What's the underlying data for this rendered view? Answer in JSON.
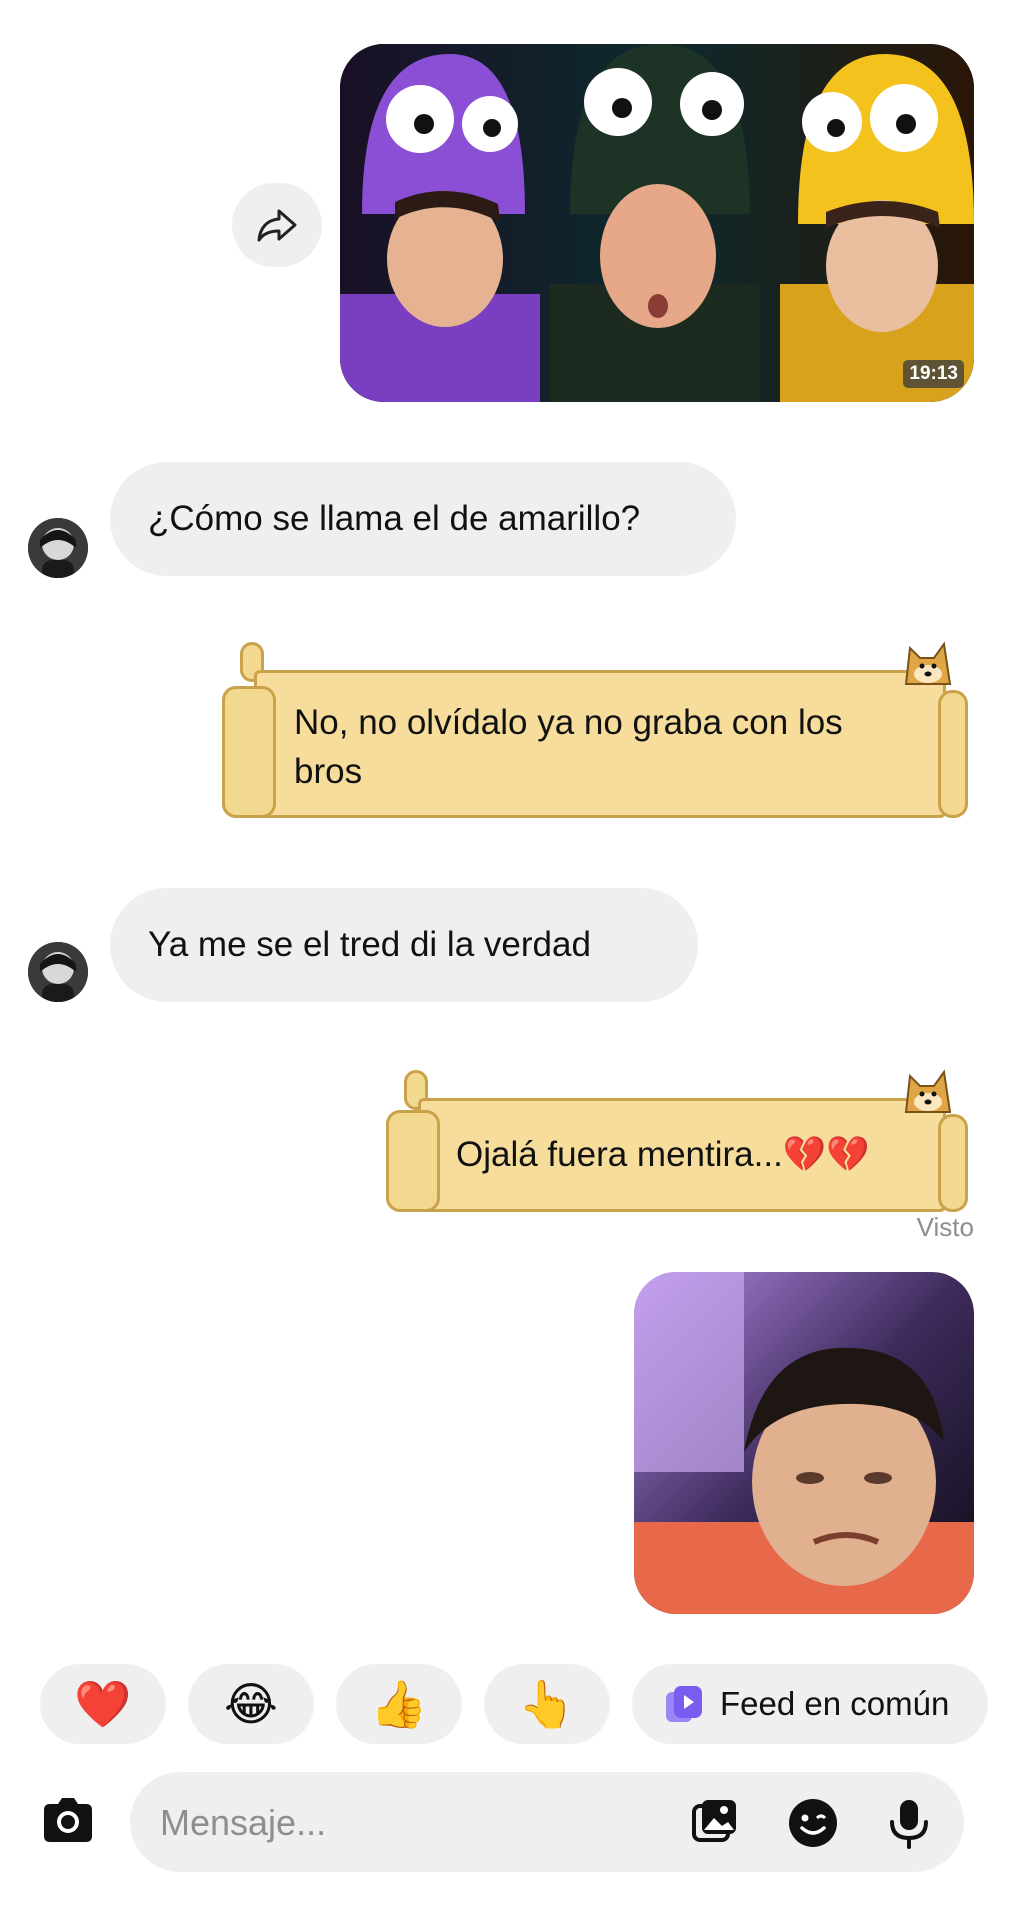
{
  "shared_video": {
    "duration": "19:13"
  },
  "messages": [
    {
      "from": "them",
      "text": "¿Cómo se llama el de amarillo?"
    },
    {
      "from": "me",
      "lines": [
        "No, no olvídalo ya no graba con los",
        "bros"
      ]
    },
    {
      "from": "them",
      "text": "Ya me se el tred di la verdad"
    },
    {
      "from": "me",
      "text": "Ojalá fuera mentira...💔💔"
    }
  ],
  "seen_label": "Visto",
  "quick_reactions": [
    "❤️",
    "😂",
    "👍",
    "👆"
  ],
  "feed_chip": {
    "label": "Feed en común"
  },
  "composer": {
    "placeholder": "Mensaje..."
  },
  "icons": {
    "share": "share-arrow-icon",
    "camera": "camera-icon",
    "gallery": "gallery-icon",
    "sticker": "sticker-icon",
    "mic": "microphone-icon",
    "feed": "shared-feed-icon"
  },
  "colors": {
    "scroll_fill": "#f6dd9b",
    "scroll_border": "#c9a24a",
    "bubble_in": "#efefef",
    "feed_icon": "#7b5cf0"
  }
}
